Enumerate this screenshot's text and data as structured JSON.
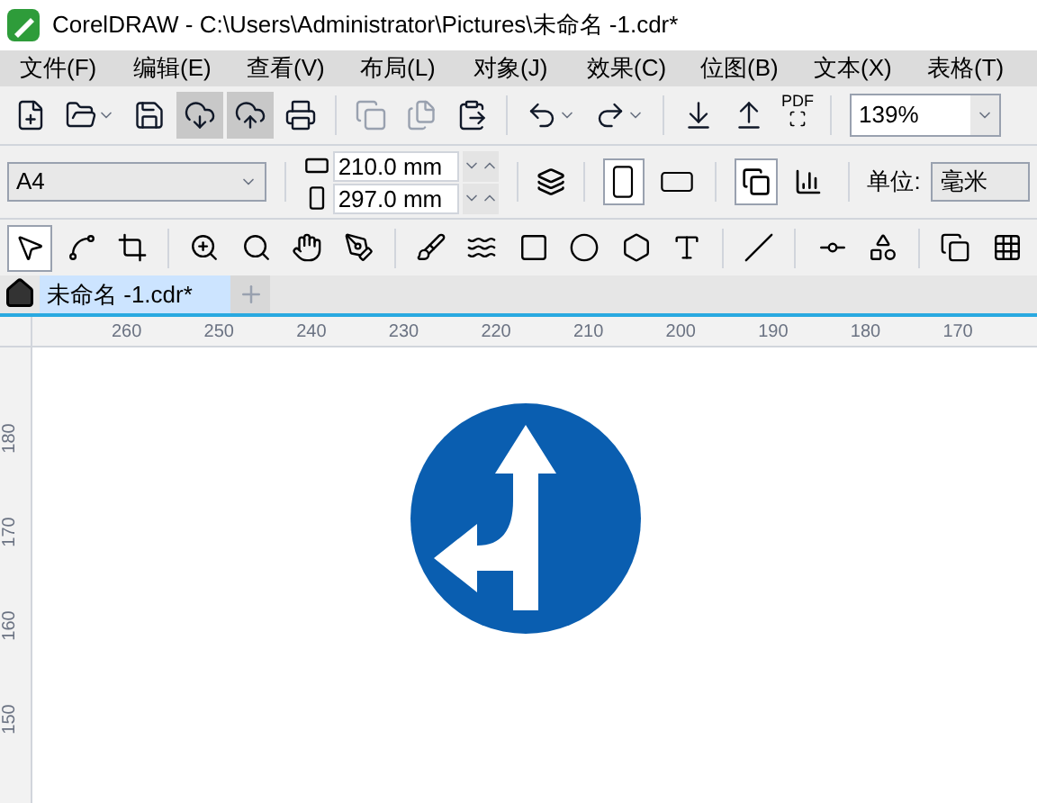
{
  "window": {
    "title": "CorelDRAW - C:\\Users\\Administrator\\Pictures\\未命名 -1.cdr*"
  },
  "menu": [
    "文件(F)",
    "编辑(E)",
    "查看(V)",
    "布局(L)",
    "对象(J)",
    "效果(C)",
    "位图(B)",
    "文本(X)",
    "表格(T)"
  ],
  "standard_toolbar": {
    "buttons": [
      {
        "selected": false,
        "disabled": false
      },
      {
        "selected": false,
        "disabled": false
      },
      {
        "selected": false,
        "disabled": false
      },
      {
        "selected": true,
        "disabled": false
      },
      {
        "selected": true,
        "disabled": false
      },
      {
        "selected": false,
        "disabled": false
      },
      {
        "selected": false,
        "disabled": true
      },
      {
        "selected": false,
        "disabled": true
      },
      {
        "selected": false,
        "disabled": false
      },
      {
        "selected": false,
        "disabled": false
      },
      {
        "selected": false,
        "disabled": false
      },
      {
        "selected": false,
        "disabled": false
      },
      {
        "selected": false,
        "disabled": false
      },
      {
        "selected": false,
        "disabled": false
      }
    ],
    "pdf_label": "PDF",
    "zoom": "139%"
  },
  "property_bar": {
    "page_size": "A4",
    "width": "210.0 mm",
    "height": "297.0 mm",
    "orientation": [
      {
        "selected": true
      },
      {
        "selected": false
      }
    ],
    "page_layout": [
      {
        "selected": true
      },
      {
        "selected": false
      }
    ],
    "unit_label": "单位:",
    "unit": "毫米"
  },
  "toolbox": [
    {
      "selected": true
    },
    {
      "selected": false
    },
    {
      "selected": false
    },
    {
      "selected": false
    },
    {
      "selected": false
    },
    {
      "selected": false
    },
    {
      "selected": false
    },
    {
      "selected": false
    },
    {
      "selected": false
    },
    {
      "selected": false
    },
    {
      "selected": false
    },
    {
      "selected": false
    },
    {
      "selected": false
    },
    {
      "selected": false
    },
    {
      "selected": false
    },
    {
      "selected": false
    },
    {
      "selected": false
    },
    {
      "selected": false
    }
  ],
  "tabs": [
    {
      "label": "未命名 -1.cdr*",
      "selected": true
    }
  ],
  "rulers": {
    "horizontal": [
      "260",
      "250",
      "240",
      "230",
      "220",
      "210",
      "200",
      "190",
      "180",
      "170"
    ],
    "vertical": [
      "180",
      "170",
      "160",
      "150"
    ]
  }
}
